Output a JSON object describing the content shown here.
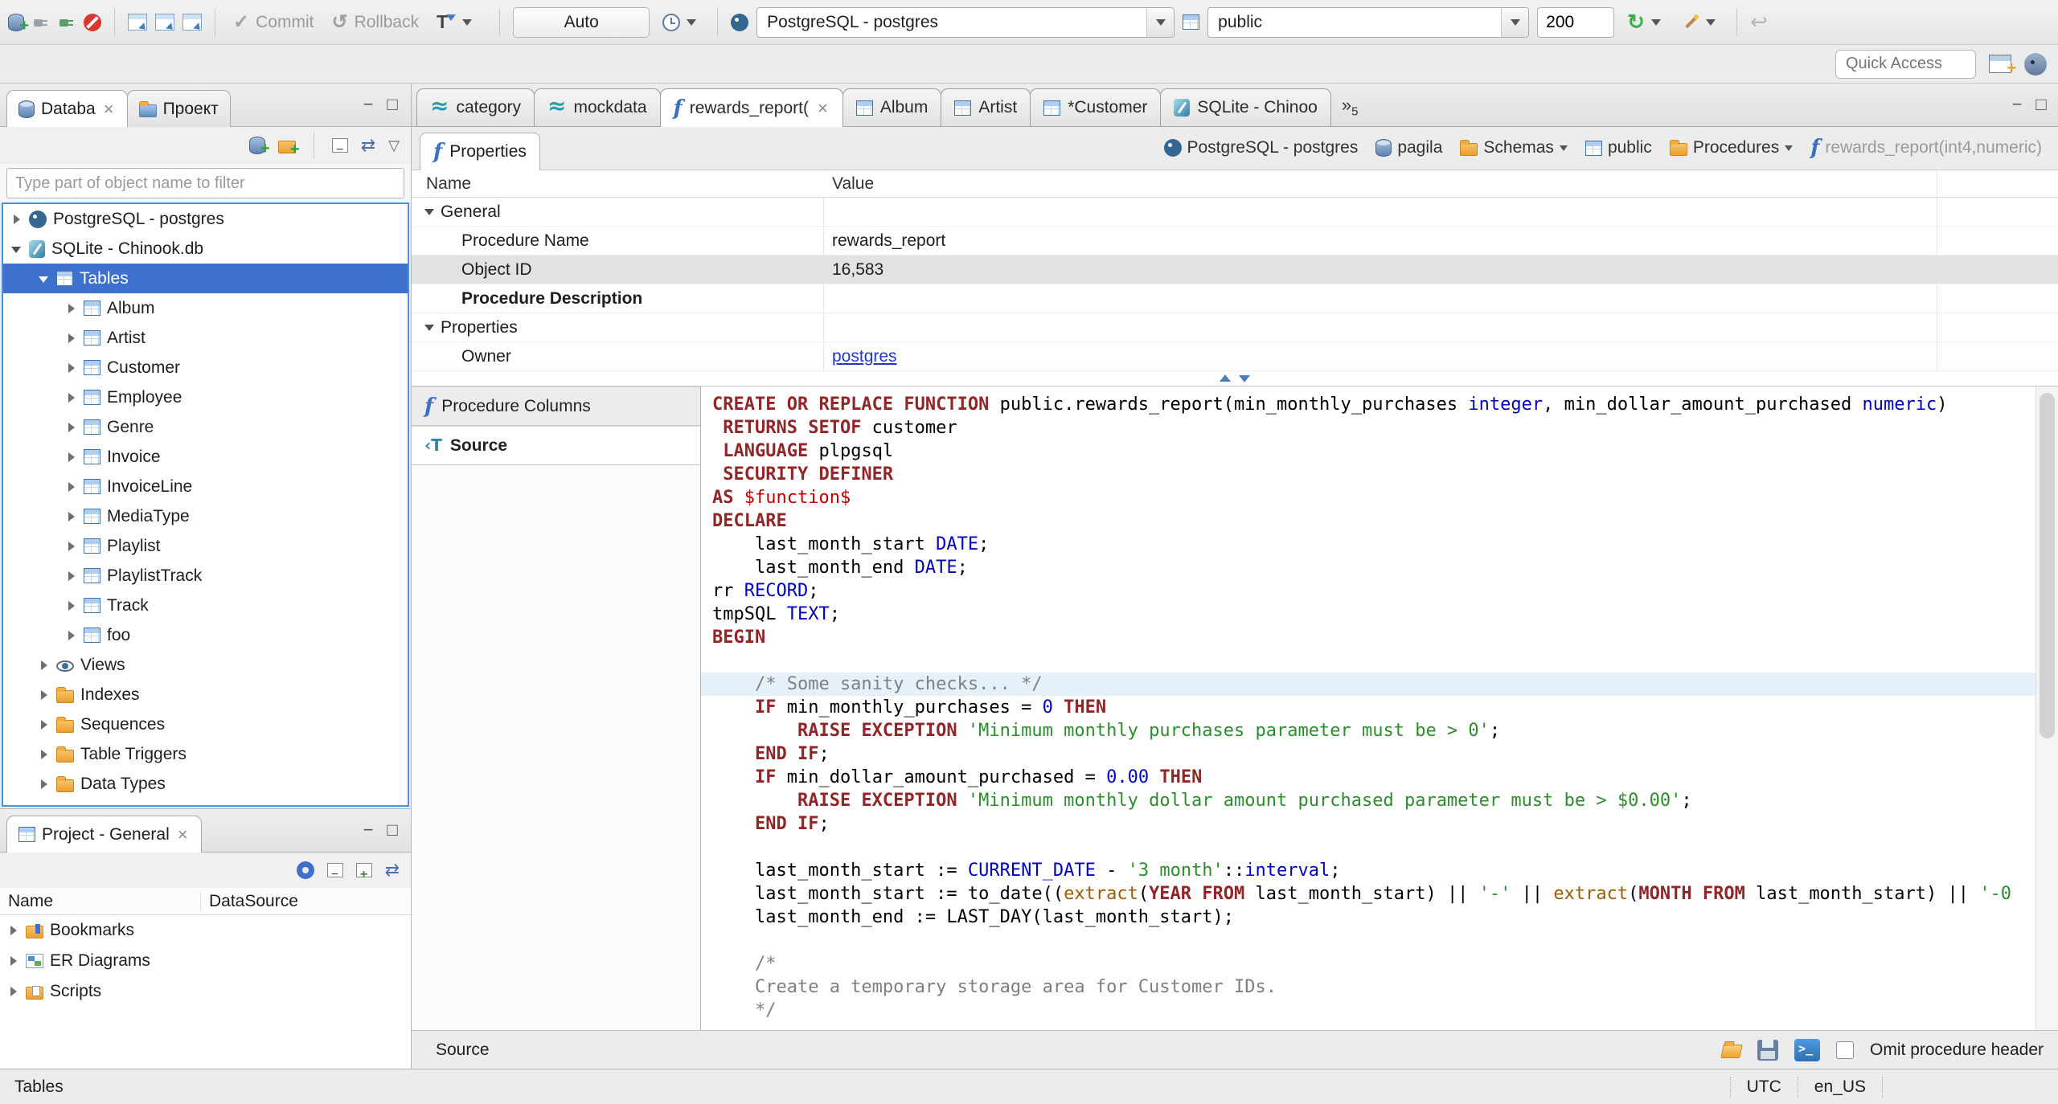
{
  "colors": {
    "selection": "#3e71ce",
    "keyword": "#8f2628",
    "type": "#0000c0",
    "string": "#2d8c2d",
    "comment": "#7f7f7f",
    "dollar_quote": "#c00000",
    "function": "#9c5d00",
    "link": "#2336c9"
  },
  "toolbar": {
    "commit_label": "Commit",
    "rollback_label": "Rollback",
    "auto_label": "Auto",
    "connection_combo": "PostgreSQL - postgres",
    "schema_combo": "public",
    "fetch_size": "200",
    "quick_access_placeholder": "Quick Access"
  },
  "nav": {
    "tabs": [
      {
        "label": "Databa"
      },
      {
        "label": "Проект"
      }
    ],
    "filter_placeholder": "Type part of object name to filter",
    "tree": [
      {
        "label": "PostgreSQL - postgres",
        "icon": "postgres",
        "level": 0,
        "state": "collapsed"
      },
      {
        "label": "SQLite - Chinook.db",
        "icon": "sqlite",
        "level": 0,
        "state": "expanded"
      },
      {
        "label": "Tables",
        "icon": "table-folder",
        "level": 1,
        "state": "expanded",
        "selected": true
      },
      {
        "label": "Album",
        "icon": "table",
        "level": 2,
        "state": "collapsed"
      },
      {
        "label": "Artist",
        "icon": "table",
        "level": 2,
        "state": "collapsed"
      },
      {
        "label": "Customer",
        "icon": "table",
        "level": 2,
        "state": "collapsed"
      },
      {
        "label": "Employee",
        "icon": "table",
        "level": 2,
        "state": "collapsed"
      },
      {
        "label": "Genre",
        "icon": "table",
        "level": 2,
        "state": "collapsed"
      },
      {
        "label": "Invoice",
        "icon": "table",
        "level": 2,
        "state": "collapsed"
      },
      {
        "label": "InvoiceLine",
        "icon": "table",
        "level": 2,
        "state": "collapsed"
      },
      {
        "label": "MediaType",
        "icon": "table",
        "level": 2,
        "state": "collapsed"
      },
      {
        "label": "Playlist",
        "icon": "table",
        "level": 2,
        "state": "collapsed"
      },
      {
        "label": "PlaylistTrack",
        "icon": "table",
        "level": 2,
        "state": "collapsed"
      },
      {
        "label": "Track",
        "icon": "table",
        "level": 2,
        "state": "collapsed"
      },
      {
        "label": "foo",
        "icon": "table",
        "level": 2,
        "state": "collapsed"
      },
      {
        "label": "Views",
        "icon": "eye",
        "level": 1,
        "state": "collapsed"
      },
      {
        "label": "Indexes",
        "icon": "folder",
        "level": 1,
        "state": "collapsed"
      },
      {
        "label": "Sequences",
        "icon": "folder",
        "level": 1,
        "state": "collapsed"
      },
      {
        "label": "Table Triggers",
        "icon": "folder",
        "level": 1,
        "state": "collapsed"
      },
      {
        "label": "Data Types",
        "icon": "folder",
        "level": 1,
        "state": "collapsed"
      }
    ]
  },
  "project": {
    "tab_label": "Project - General",
    "columns": [
      "Name",
      "DataSource"
    ],
    "items": [
      {
        "label": "Bookmarks",
        "icon": "bookmarks"
      },
      {
        "label": "ER Diagrams",
        "icon": "er"
      },
      {
        "label": "Scripts",
        "icon": "scripts"
      }
    ]
  },
  "editor": {
    "tabs": [
      {
        "label": "category",
        "icon": "sqlcon"
      },
      {
        "label": "mockdata",
        "icon": "sqlcon"
      },
      {
        "label": "rewards_report(",
        "icon": "function",
        "active": true,
        "closable": true
      },
      {
        "label": "Album",
        "icon": "table"
      },
      {
        "label": "Artist",
        "icon": "table"
      },
      {
        "label": "*Customer",
        "icon": "table"
      },
      {
        "label": "SQLite - Chinoo",
        "icon": "sqlite"
      }
    ],
    "tab_overflow_count": "5",
    "properties_tab": "Properties",
    "breadcrumb": [
      {
        "label": "PostgreSQL - postgres",
        "icon": "postgres"
      },
      {
        "label": "pagila",
        "icon": "db"
      },
      {
        "label": "Schemas",
        "icon": "folder",
        "dropdown": true
      },
      {
        "label": "public",
        "icon": "schema"
      },
      {
        "label": "Procedures",
        "icon": "folder",
        "dropdown": true
      },
      {
        "label": "rewards_report(int4,numeric)",
        "icon": "function",
        "dimmed": true
      }
    ],
    "grid": {
      "columns": [
        "Name",
        "Value"
      ],
      "rows": [
        {
          "name": "General",
          "type": "group"
        },
        {
          "name": "Procedure Name",
          "value": "rewards_report"
        },
        {
          "name": "Object ID",
          "value": "16,583",
          "selected": true
        },
        {
          "name": "Procedure Description",
          "bold": true
        },
        {
          "name": "Properties",
          "type": "group"
        },
        {
          "name": "Owner",
          "value": "postgres",
          "link": true
        }
      ]
    },
    "panes": [
      {
        "label": "Procedure Columns",
        "icon": "function"
      },
      {
        "label": "Source",
        "icon": "source",
        "active": true
      }
    ],
    "status_label": "Source",
    "omit_checkbox_label": "Omit procedure header"
  },
  "code": {
    "highlight_line": 13,
    "lines": [
      [
        [
          "k",
          "CREATE OR REPLACE FUNCTION"
        ],
        [
          "p",
          " public.rewards_report(min_monthly_purchases "
        ],
        [
          "t",
          "integer"
        ],
        [
          "p",
          ", min_dollar_amount_purchased "
        ],
        [
          "t",
          "numeric"
        ],
        [
          "p",
          ")"
        ]
      ],
      [
        [
          "p",
          " "
        ],
        [
          "k",
          "RETURNS SETOF"
        ],
        [
          "p",
          " customer"
        ]
      ],
      [
        [
          "p",
          " "
        ],
        [
          "k",
          "LANGUAGE"
        ],
        [
          "p",
          " plpgsql"
        ]
      ],
      [
        [
          "p",
          " "
        ],
        [
          "k",
          "SECURITY DEFINER"
        ]
      ],
      [
        [
          "k",
          "AS"
        ],
        [
          "p",
          " "
        ],
        [
          "r",
          "$function$"
        ]
      ],
      [
        [
          "k",
          "DECLARE"
        ]
      ],
      [
        [
          "p",
          "    last_month_start "
        ],
        [
          "t",
          "DATE"
        ],
        [
          "p",
          ";"
        ]
      ],
      [
        [
          "p",
          "    last_month_end "
        ],
        [
          "t",
          "DATE"
        ],
        [
          "p",
          ";"
        ]
      ],
      [
        [
          "p",
          "rr "
        ],
        [
          "t",
          "RECORD"
        ],
        [
          "p",
          ";"
        ]
      ],
      [
        [
          "p",
          "tmpSQL "
        ],
        [
          "t",
          "TEXT"
        ],
        [
          "p",
          ";"
        ]
      ],
      [
        [
          "k",
          "BEGIN"
        ]
      ],
      [],
      [
        [
          "c",
          "    /* Some sanity checks... */"
        ]
      ],
      [
        [
          "p",
          "    "
        ],
        [
          "k",
          "IF"
        ],
        [
          "p",
          " min_monthly_purchases = "
        ],
        [
          "t",
          "0"
        ],
        [
          "p",
          " "
        ],
        [
          "k",
          "THEN"
        ]
      ],
      [
        [
          "p",
          "        "
        ],
        [
          "k",
          "RAISE EXCEPTION"
        ],
        [
          "p",
          " "
        ],
        [
          "s",
          "'Minimum monthly purchases parameter must be > 0'"
        ],
        [
          "p",
          ";"
        ]
      ],
      [
        [
          "p",
          "    "
        ],
        [
          "k",
          "END IF"
        ],
        [
          "p",
          ";"
        ]
      ],
      [
        [
          "p",
          "    "
        ],
        [
          "k",
          "IF"
        ],
        [
          "p",
          " min_dollar_amount_purchased = "
        ],
        [
          "t",
          "0.00"
        ],
        [
          "p",
          " "
        ],
        [
          "k",
          "THEN"
        ]
      ],
      [
        [
          "p",
          "        "
        ],
        [
          "k",
          "RAISE EXCEPTION"
        ],
        [
          "p",
          " "
        ],
        [
          "s",
          "'Minimum monthly dollar amount purchased parameter must be > $0.00'"
        ],
        [
          "p",
          ";"
        ]
      ],
      [
        [
          "p",
          "    "
        ],
        [
          "k",
          "END IF"
        ],
        [
          "p",
          ";"
        ]
      ],
      [],
      [
        [
          "p",
          "    last_month_start := "
        ],
        [
          "t",
          "CURRENT_DATE"
        ],
        [
          "p",
          " - "
        ],
        [
          "s",
          "'3 month'"
        ],
        [
          "p",
          "::"
        ],
        [
          "t",
          "interval"
        ],
        [
          "p",
          ";"
        ]
      ],
      [
        [
          "p",
          "    last_month_start := to_date(("
        ],
        [
          "f",
          "extract"
        ],
        [
          "p",
          "("
        ],
        [
          "k",
          "YEAR FROM"
        ],
        [
          "p",
          " last_month_start) || "
        ],
        [
          "s",
          "'-'"
        ],
        [
          "p",
          " || "
        ],
        [
          "f",
          "extract"
        ],
        [
          "p",
          "("
        ],
        [
          "k",
          "MONTH FROM"
        ],
        [
          "p",
          " last_month_start) || "
        ],
        [
          "s",
          "'-0"
        ]
      ],
      [
        [
          "p",
          "    last_month_end := LAST_DAY(last_month_start);"
        ]
      ],
      [],
      [
        [
          "c",
          "    /*"
        ]
      ],
      [
        [
          "c",
          "    Create a temporary storage area for Customer IDs."
        ]
      ],
      [
        [
          "c",
          "    */"
        ]
      ]
    ]
  },
  "statusbar": {
    "left": "Tables",
    "timezone": "UTC",
    "locale": "en_US"
  }
}
